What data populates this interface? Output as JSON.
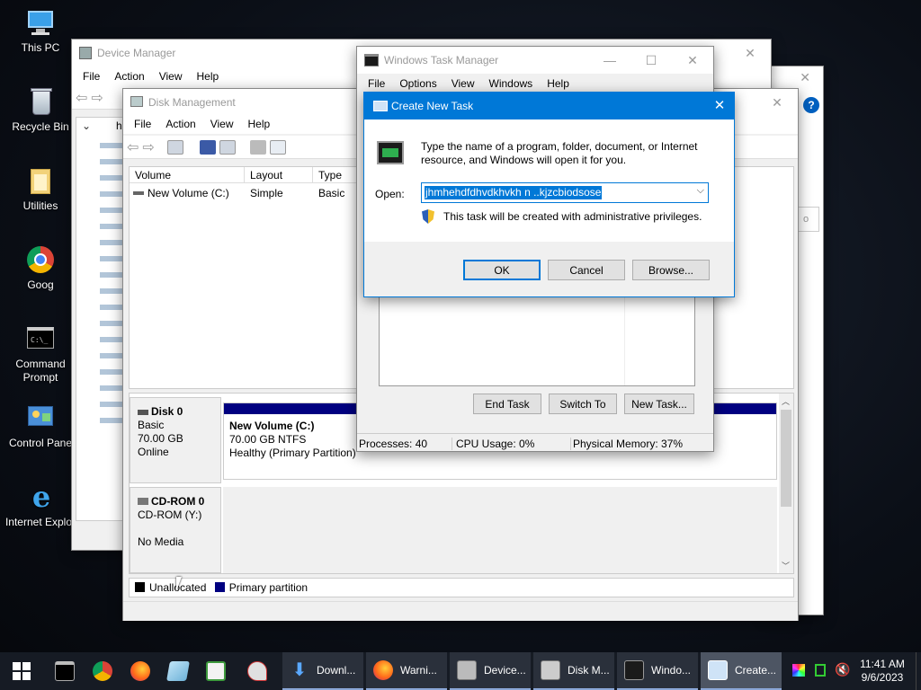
{
  "desktop": {
    "icons": [
      {
        "label": "This PC",
        "icon": "this-pc-icon"
      },
      {
        "label": "Recycle Bin",
        "icon": "recycle-bin-icon"
      },
      {
        "label": "Utilities",
        "icon": "folder-icon"
      },
      {
        "label": "Goog",
        "icon": "chrome-icon"
      },
      {
        "label": "Command Prompt",
        "label1": "Command",
        "label2": "Prompt",
        "icon": "command-prompt-icon"
      },
      {
        "label": "Control Pane",
        "icon": "control-panel-icon"
      },
      {
        "label": "Internet Explor",
        "icon": "internet-explorer-icon"
      }
    ]
  },
  "device_manager": {
    "title": "Device Manager",
    "menu": [
      "File",
      "Action",
      "View",
      "Help"
    ],
    "tree_root_partial": "h"
  },
  "disk_management": {
    "title": "Disk Management",
    "menu": [
      "File",
      "Action",
      "View",
      "Help"
    ],
    "columns": [
      "Volume",
      "Layout",
      "Type"
    ],
    "rows": [
      {
        "volume": "New Volume (C:)",
        "layout": "Simple",
        "type": "Basic"
      }
    ],
    "disks": [
      {
        "name": "Disk 0",
        "kind": "Basic",
        "size": "70.00 GB",
        "status": "Online",
        "partition": {
          "name": "New Volume  (C:)",
          "size_fs": "70.00 GB NTFS",
          "health": "Healthy (Primary Partition)"
        }
      },
      {
        "name": "CD-ROM 0",
        "kind": "CD-ROM (Y:)",
        "size": "",
        "status": "No Media"
      }
    ],
    "legend": [
      {
        "label": "Unallocated",
        "color": "#000000"
      },
      {
        "label": "Primary partition",
        "color": "#000080"
      }
    ]
  },
  "task_manager": {
    "title": "Windows Task Manager",
    "menu": [
      "File",
      "Options",
      "View",
      "Windows",
      "Help"
    ],
    "buttons": {
      "end_task": "End Task",
      "switch_to": "Switch To",
      "new_task": "New Task..."
    },
    "status": {
      "processes": "Processes: 40",
      "cpu": "CPU Usage: 0%",
      "memory": "Physical Memory: 37%"
    }
  },
  "create_task": {
    "title": "Create New Task",
    "description": "Type the name of a program, folder, document, or Internet resource, and Windows will open it for you.",
    "open_label": "Open:",
    "open_value": "jhmhehdfdhvdkhvkh n ..kjzcbiodsose",
    "admin_note": "This task will be created with administrative privileges.",
    "ok": "OK",
    "cancel": "Cancel",
    "browse": "Browse..."
  },
  "taskbar": {
    "windows": [
      {
        "label": "Downl...",
        "icon": "download-icon"
      },
      {
        "label": "Warni...",
        "icon": "firefox-icon"
      },
      {
        "label": "Device...",
        "icon": "device-manager-icon"
      },
      {
        "label": "Disk M...",
        "icon": "disk-management-icon"
      },
      {
        "label": "Windo...",
        "icon": "task-manager-icon"
      },
      {
        "label": "Create...",
        "icon": "run-icon"
      }
    ],
    "time": "11:41 AM",
    "date": "9/6/2023"
  },
  "colors": {
    "accent": "#0078d7",
    "partition_bar": "#000080",
    "taskbar": "#161b24"
  }
}
